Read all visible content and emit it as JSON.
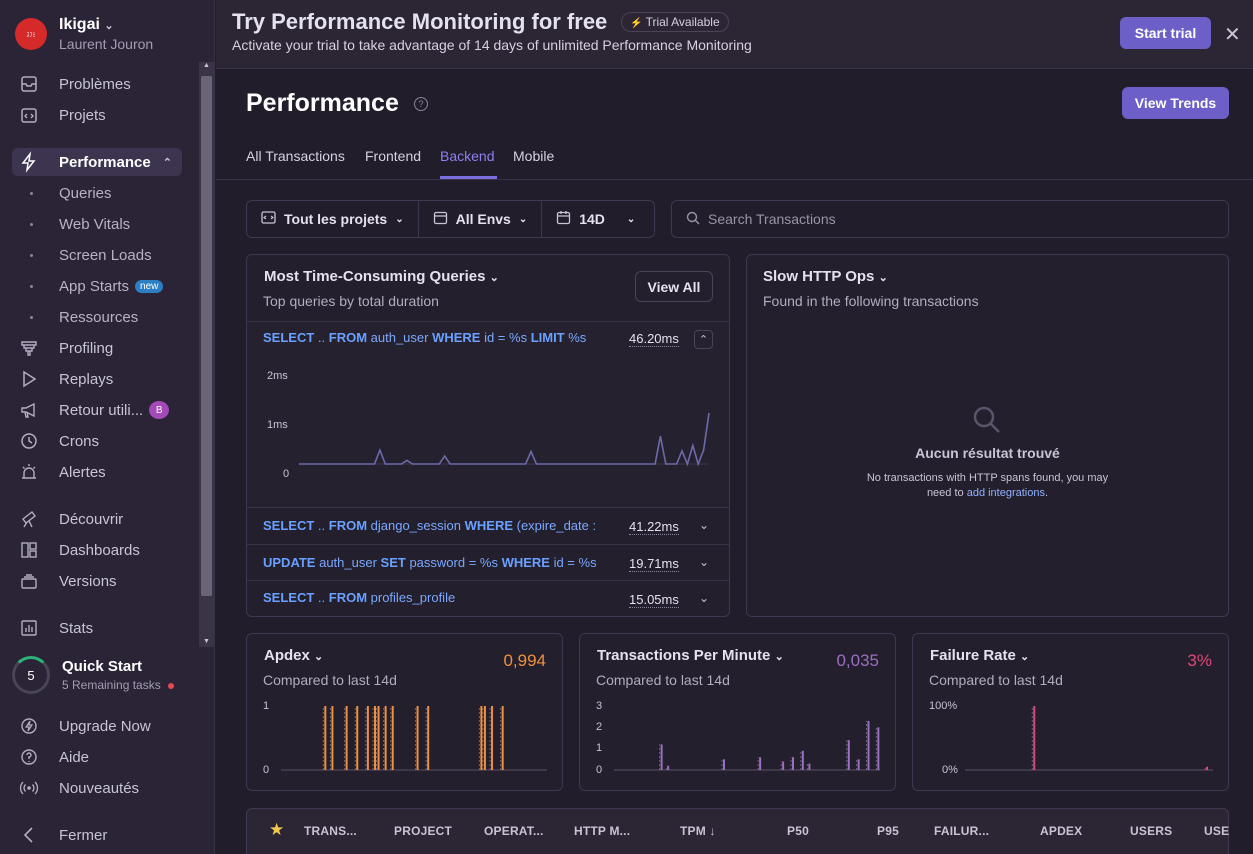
{
  "sidebar": {
    "org_name": "Ikigai",
    "org_user": "Laurent Jouron",
    "avatar_text": "ｽﾌﾐ",
    "items": [
      {
        "label": "Problèmes",
        "icon": "inbox-icon"
      },
      {
        "label": "Projets",
        "icon": "code-folder-icon"
      },
      {
        "label": "Performance",
        "icon": "lightning-icon"
      },
      {
        "label": "Profiling",
        "icon": "profiling-icon"
      },
      {
        "label": "Replays",
        "icon": "play-icon"
      },
      {
        "label": "Retour utili...",
        "icon": "megaphone-icon",
        "badge": "B"
      },
      {
        "label": "Crons",
        "icon": "clock-icon"
      },
      {
        "label": "Alertes",
        "icon": "siren-icon"
      },
      {
        "label": "Découvrir",
        "icon": "telescope-icon"
      },
      {
        "label": "Dashboards",
        "icon": "dashboard-icon"
      },
      {
        "label": "Versions",
        "icon": "stack-icon"
      },
      {
        "label": "Stats",
        "icon": "bar-chart-icon"
      }
    ],
    "sub_items": [
      {
        "label": "Queries"
      },
      {
        "label": "Web Vitals"
      },
      {
        "label": "Screen Loads"
      },
      {
        "label": "App Starts",
        "badge": "new"
      },
      {
        "label": "Ressources"
      }
    ],
    "quick_start": {
      "count": "5",
      "title": "Quick Start",
      "subtitle": "5 Remaining tasks"
    },
    "bottom": [
      {
        "label": "Upgrade Now"
      },
      {
        "label": "Aide"
      },
      {
        "label": "Nouveautés"
      },
      {
        "label": "Fermer"
      }
    ]
  },
  "banner": {
    "title": "Try Performance Monitoring for free",
    "pill": "Trial Available",
    "subtitle": "Activate your trial to take advantage of 14 days of unlimited Performance Monitoring",
    "start_trial": "Start trial"
  },
  "header": {
    "title": "Performance",
    "view_trends": "View Trends",
    "tabs": [
      "All Transactions",
      "Frontend",
      "Backend",
      "Mobile"
    ],
    "active_tab": "Backend"
  },
  "filters": {
    "projects": "Tout les projets",
    "envs": "All Envs",
    "period": "14D",
    "search_placeholder": "Search Transactions"
  },
  "queries_panel": {
    "title": "Most Time-Consuming Queries",
    "subtitle": "Top queries by total duration",
    "view_all": "View All",
    "rows": [
      {
        "parts": [
          [
            "kw",
            "SELECT"
          ],
          [
            "t",
            " .. "
          ],
          [
            "kw",
            "FROM"
          ],
          [
            "t",
            " auth_user "
          ],
          [
            "kw",
            "WHERE"
          ],
          [
            "t",
            " id = %s "
          ],
          [
            "kw",
            "LIMIT"
          ],
          [
            "t",
            " %s"
          ]
        ],
        "value": "46.20ms"
      },
      {
        "parts": [
          [
            "kw",
            "SELECT"
          ],
          [
            "t",
            " .. "
          ],
          [
            "kw",
            "FROM"
          ],
          [
            "t",
            " django_session "
          ],
          [
            "kw",
            "WHERE"
          ],
          [
            "t",
            " (expire_date :"
          ]
        ],
        "value": "41.22ms"
      },
      {
        "parts": [
          [
            "kw",
            "UPDATE"
          ],
          [
            "t",
            " auth_user "
          ],
          [
            "kw",
            "SET"
          ],
          [
            "t",
            " password = %s "
          ],
          [
            "kw",
            "WHERE"
          ],
          [
            "t",
            " id = %s"
          ]
        ],
        "value": "19.71ms"
      },
      {
        "parts": [
          [
            "kw",
            "SELECT"
          ],
          [
            "t",
            " .. "
          ],
          [
            "kw",
            "FROM"
          ],
          [
            "t",
            " profiles_profile"
          ]
        ],
        "value": "15.05ms"
      }
    ],
    "y_ticks": [
      "2ms",
      "1ms",
      "0"
    ]
  },
  "http_panel": {
    "title": "Slow HTTP Ops",
    "subtitle": "Found in the following transactions",
    "empty_title": "Aucun résultat trouvé",
    "empty_text_1": "No transactions with HTTP spans found, you may",
    "empty_text_2": "need to",
    "empty_link": "add integrations",
    "empty_end": "."
  },
  "metrics": [
    {
      "title": "Apdex",
      "subtitle": "Compared to last 14d",
      "value": "0,994",
      "color": "#f28f3b",
      "y_ticks": [
        "1",
        "0"
      ]
    },
    {
      "title": "Transactions Per Minute",
      "subtitle": "Compared to last 14d",
      "value": "0,035",
      "color": "#9b6fc2",
      "y_ticks": [
        "3",
        "2",
        "1",
        "0"
      ]
    },
    {
      "title": "Failure Rate",
      "subtitle": "Compared to last 14d",
      "value": "3%",
      "color": "#e0487a",
      "y_ticks": [
        "100%",
        "0%"
      ]
    }
  ],
  "table": {
    "columns": [
      "TRANS...",
      "PROJECT",
      "OPERAT...",
      "HTTP M...",
      "TPM",
      "P50",
      "P95",
      "FAILUR...",
      "APDEX",
      "USERS",
      "USE"
    ]
  },
  "chart_data": [
    {
      "type": "line",
      "title": "",
      "xlabel": "",
      "ylabel": "",
      "ylim": [
        0,
        2.2
      ],
      "series": [
        {
          "values": [
            0,
            0,
            0,
            0,
            0,
            0,
            0,
            0,
            0,
            0,
            0,
            0,
            0,
            0,
            0,
            0.3,
            0,
            0,
            0,
            0,
            0.08,
            0,
            0,
            0,
            0,
            0,
            0,
            0.17,
            0,
            0,
            0,
            0,
            0,
            0,
            0,
            0,
            0,
            0,
            0,
            0,
            0,
            0,
            0,
            0.27,
            0,
            0,
            0,
            0,
            0,
            0,
            0,
            0,
            0,
            0,
            0,
            0,
            0,
            0,
            0,
            0,
            0,
            0,
            0,
            0,
            0,
            0,
            0,
            0.6,
            0,
            0,
            0,
            0.28,
            0,
            0.4,
            0,
            0.3,
            1.1
          ]
        }
      ]
    },
    {
      "type": "bar",
      "ylim": [
        0,
        1
      ],
      "series": [
        {
          "values": [
            0,
            0,
            0,
            0,
            0,
            0,
            0,
            0,
            0,
            0,
            0,
            0,
            1,
            0,
            1,
            0,
            0,
            0,
            1,
            0,
            0,
            1,
            0,
            0,
            1,
            0,
            1,
            1,
            0,
            1,
            0,
            1,
            0,
            0,
            0,
            0,
            0,
            0,
            1,
            0,
            0,
            1,
            0,
            0,
            0,
            0,
            0,
            0,
            0,
            0,
            0,
            0,
            0,
            0,
            0,
            0,
            1,
            1,
            0,
            1,
            0,
            0,
            1,
            0,
            0,
            0,
            0,
            0,
            0,
            0,
            0,
            0,
            0,
            0,
            0
          ]
        }
      ]
    },
    {
      "type": "bar",
      "ylim": [
        0,
        3
      ],
      "series": [
        {
          "values": [
            0,
            0,
            0,
            0,
            0,
            0,
            0,
            0,
            0,
            0,
            0,
            0,
            0,
            0,
            1.2,
            0,
            0.2,
            0,
            0,
            0,
            0,
            0,
            0,
            0,
            0,
            0,
            0,
            0,
            0,
            0,
            0,
            0,
            0,
            0.5,
            0,
            0,
            0,
            0,
            0,
            0,
            0,
            0,
            0,
            0,
            0.6,
            0,
            0,
            0,
            0,
            0,
            0,
            0.4,
            0,
            0,
            0.6,
            0,
            0,
            0.9,
            0,
            0.3,
            0,
            0,
            0,
            0,
            0,
            0,
            0,
            0,
            0,
            0,
            0,
            1.4,
            0,
            0,
            0.5,
            0,
            0,
            2.3,
            0,
            0,
            2.0
          ]
        }
      ]
    },
    {
      "type": "bar",
      "ylim": [
        0,
        100
      ],
      "series": [
        {
          "values": [
            0,
            0,
            0,
            0,
            0,
            0,
            0,
            0,
            0,
            0,
            0,
            0,
            0,
            0,
            0,
            0,
            0,
            0,
            0,
            0,
            0,
            0,
            0,
            0,
            0,
            0,
            0,
            0,
            0,
            0,
            0,
            0,
            0,
            0,
            0,
            0,
            0,
            0,
            0,
            0,
            100,
            0,
            0,
            0,
            0,
            0,
            0,
            0,
            0,
            0,
            0,
            0,
            0,
            0,
            0,
            0,
            0,
            0,
            0,
            0,
            0,
            0,
            0,
            0,
            0,
            0,
            0,
            0,
            0,
            0,
            0,
            0,
            0,
            0,
            0,
            0,
            0,
            0,
            0,
            0,
            0,
            0,
            0,
            0,
            0,
            0,
            0,
            0,
            0,
            0,
            0,
            0,
            0,
            0,
            0,
            0,
            0,
            0,
            0,
            0,
            0,
            0,
            0,
            0,
            0,
            0,
            0,
            0,
            0,
            0,
            0,
            0,
            0,
            0,
            0,
            0,
            0,
            0,
            0,
            0,
            0,
            0,
            0,
            0,
            0,
            0,
            0,
            0,
            0,
            0,
            0,
            0,
            0,
            0,
            0,
            0,
            0,
            0,
            0,
            0,
            0,
            5,
            0,
            0,
            0
          ]
        }
      ]
    }
  ]
}
